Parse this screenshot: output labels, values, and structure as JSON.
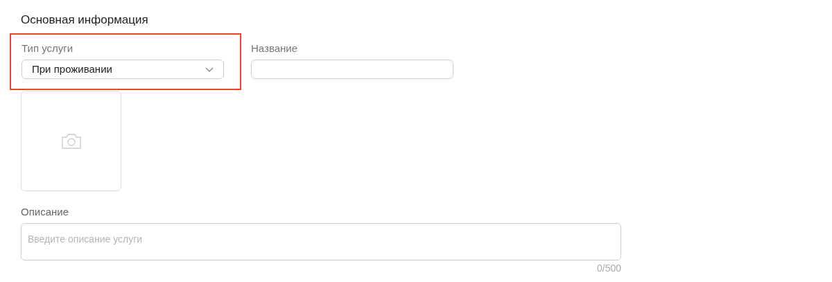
{
  "section": {
    "title": "Основная информация"
  },
  "service_type": {
    "label": "Тип услуги",
    "value": "При проживании",
    "highlighted": true
  },
  "name_field": {
    "label": "Название"
  },
  "photo": {
    "kind": "upload"
  },
  "description": {
    "label": "Описание",
    "placeholder": "Введите описание услуги",
    "counter": "0/500"
  }
}
